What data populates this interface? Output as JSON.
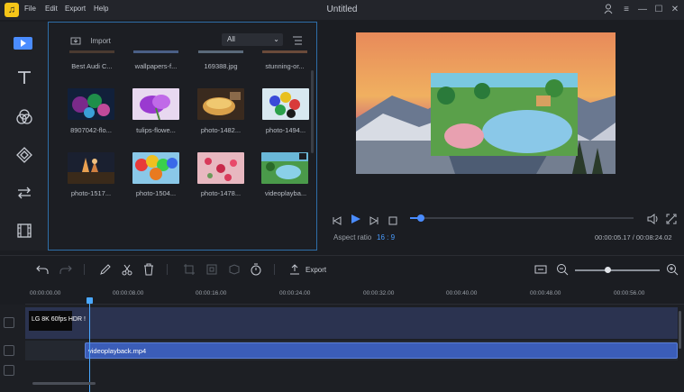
{
  "app": {
    "title": "Untitled",
    "menu": [
      "File",
      "Edit",
      "Export",
      "Help"
    ]
  },
  "media_panel": {
    "import_label": "Import",
    "filter_value": "All",
    "top_row_labels": [
      "Best Audi C...",
      "wallpapers-f...",
      "169388.jpg",
      "stunning-or..."
    ],
    "items": [
      {
        "label": "8907042-flo..."
      },
      {
        "label": "tulips-flowe..."
      },
      {
        "label": "photo-1482..."
      },
      {
        "label": "photo-1494..."
      },
      {
        "label": "photo-1517..."
      },
      {
        "label": "photo-1504..."
      },
      {
        "label": "photo-1478..."
      },
      {
        "label": "videoplayba..."
      }
    ]
  },
  "preview": {
    "aspect_label": "Aspect ratio",
    "aspect_value": "16 : 9",
    "timecode": "00:00:05.17 / 00:08:24.02",
    "progress": 0.05
  },
  "timeline": {
    "export_label": "Export",
    "zoom_level": 0.38,
    "ruler": [
      "00:00:00.00",
      "00:00:08.00",
      "00:00:16.00",
      "00:00:24.00",
      "00:00:32.00",
      "00:00:40.00",
      "00:00:48.00",
      "00:00:56.00"
    ],
    "video_clip_label": "LG 8K 60fps HDR !",
    "audio_clip_label": "videoplayback.mp4"
  },
  "colors": {
    "accent": "#4a8cff",
    "audio_clip": "#3b5db8",
    "video_track": "#2b3350"
  }
}
